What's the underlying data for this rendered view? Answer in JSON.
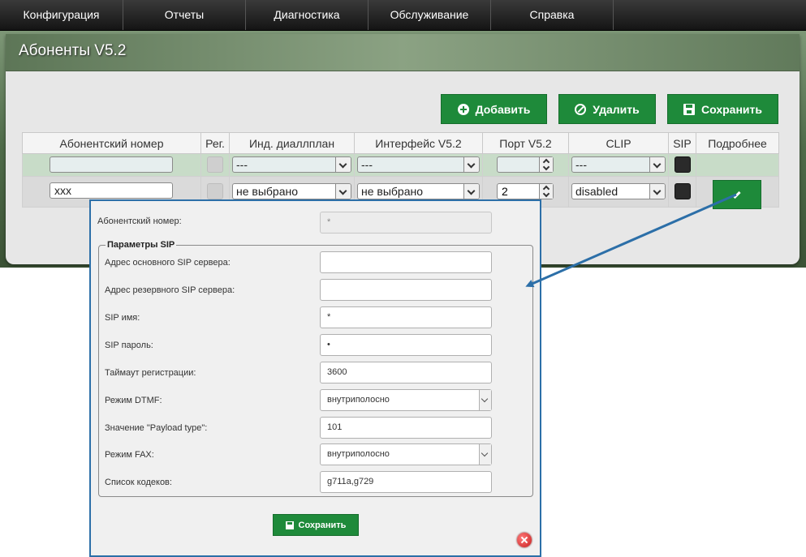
{
  "nav": [
    "Конфигурация",
    "Отчеты",
    "Диагностика",
    "Обслуживание",
    "Справка"
  ],
  "page": {
    "title": "Абоненты V5.2"
  },
  "toolbar": {
    "add": "Добавить",
    "delete": "Удалить",
    "save": "Сохранить"
  },
  "table": {
    "headers": [
      "Абонентский номер",
      "Рег.",
      "Инд. диаллплан",
      "Интерфейс V5.2",
      "Порт V5.2",
      "CLIP",
      "SIP",
      "Подробнее"
    ],
    "row1": {
      "number": "",
      "dialplan": "---",
      "interface": "---",
      "port": "",
      "clip": "---"
    },
    "row2": {
      "number": "xxx",
      "dialplan": "не выбрано",
      "interface": "не выбрано",
      "port": "2",
      "clip": "disabled"
    }
  },
  "popup": {
    "subscriber_label": "Абонентский номер:",
    "subscriber_value": "*",
    "sip_legend": "Параметры SIP",
    "fields": {
      "primary_server": {
        "label": "Адрес основного SIP сервера:",
        "value": ""
      },
      "backup_server": {
        "label": "Адрес резервного SIP сервера:",
        "value": ""
      },
      "sip_name": {
        "label": "SIP имя:",
        "value": "*"
      },
      "sip_password": {
        "label": "SIP пароль:",
        "value": "•"
      },
      "reg_timeout": {
        "label": "Таймаут регистрации:",
        "value": "3600"
      },
      "dtmf_mode": {
        "label": "Режим DTMF:",
        "value": "внутриполосно"
      },
      "payload_type": {
        "label": "Значение \"Payload type\":",
        "value": "101"
      },
      "fax_mode": {
        "label": "Режим FAX:",
        "value": "внутриполосно"
      },
      "codecs": {
        "label": "Список кодеков:",
        "value": "g711a,g729"
      }
    },
    "save": "Сохранить"
  },
  "colors": {
    "accent": "#1e8a3a",
    "arrow": "#2c6fa8"
  }
}
